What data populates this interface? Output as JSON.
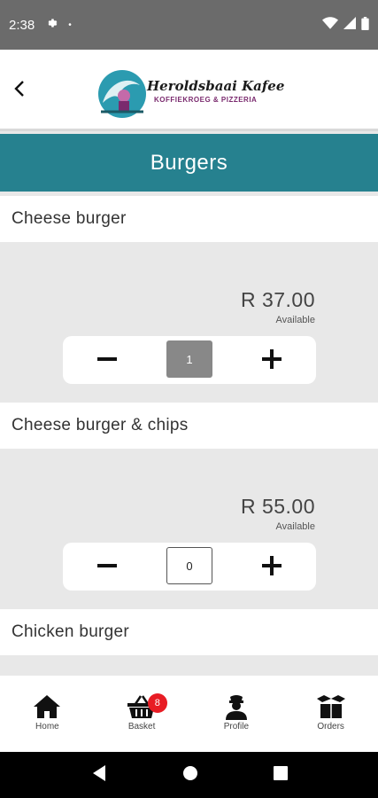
{
  "status_bar": {
    "time": "2:38",
    "dot": "•"
  },
  "header": {
    "logo_name": "Heroldsbaai Kafee",
    "logo_subtitle": "KOFFIEKROEG & PIZZERIA"
  },
  "category": {
    "title": "Burgers"
  },
  "items": [
    {
      "name": "Cheese burger",
      "price": "R 37.00",
      "availability": "Available",
      "quantity": "1"
    },
    {
      "name": "Cheese burger & chips",
      "price": "R 55.00",
      "availability": "Available",
      "quantity": "0"
    },
    {
      "name": "Chicken burger"
    }
  ],
  "bottom_nav": {
    "home": "Home",
    "basket": "Basket",
    "basket_badge": "8",
    "profile": "Profile",
    "orders": "Orders"
  },
  "colors": {
    "accent": "#26818f",
    "badge": "#e81c24"
  }
}
